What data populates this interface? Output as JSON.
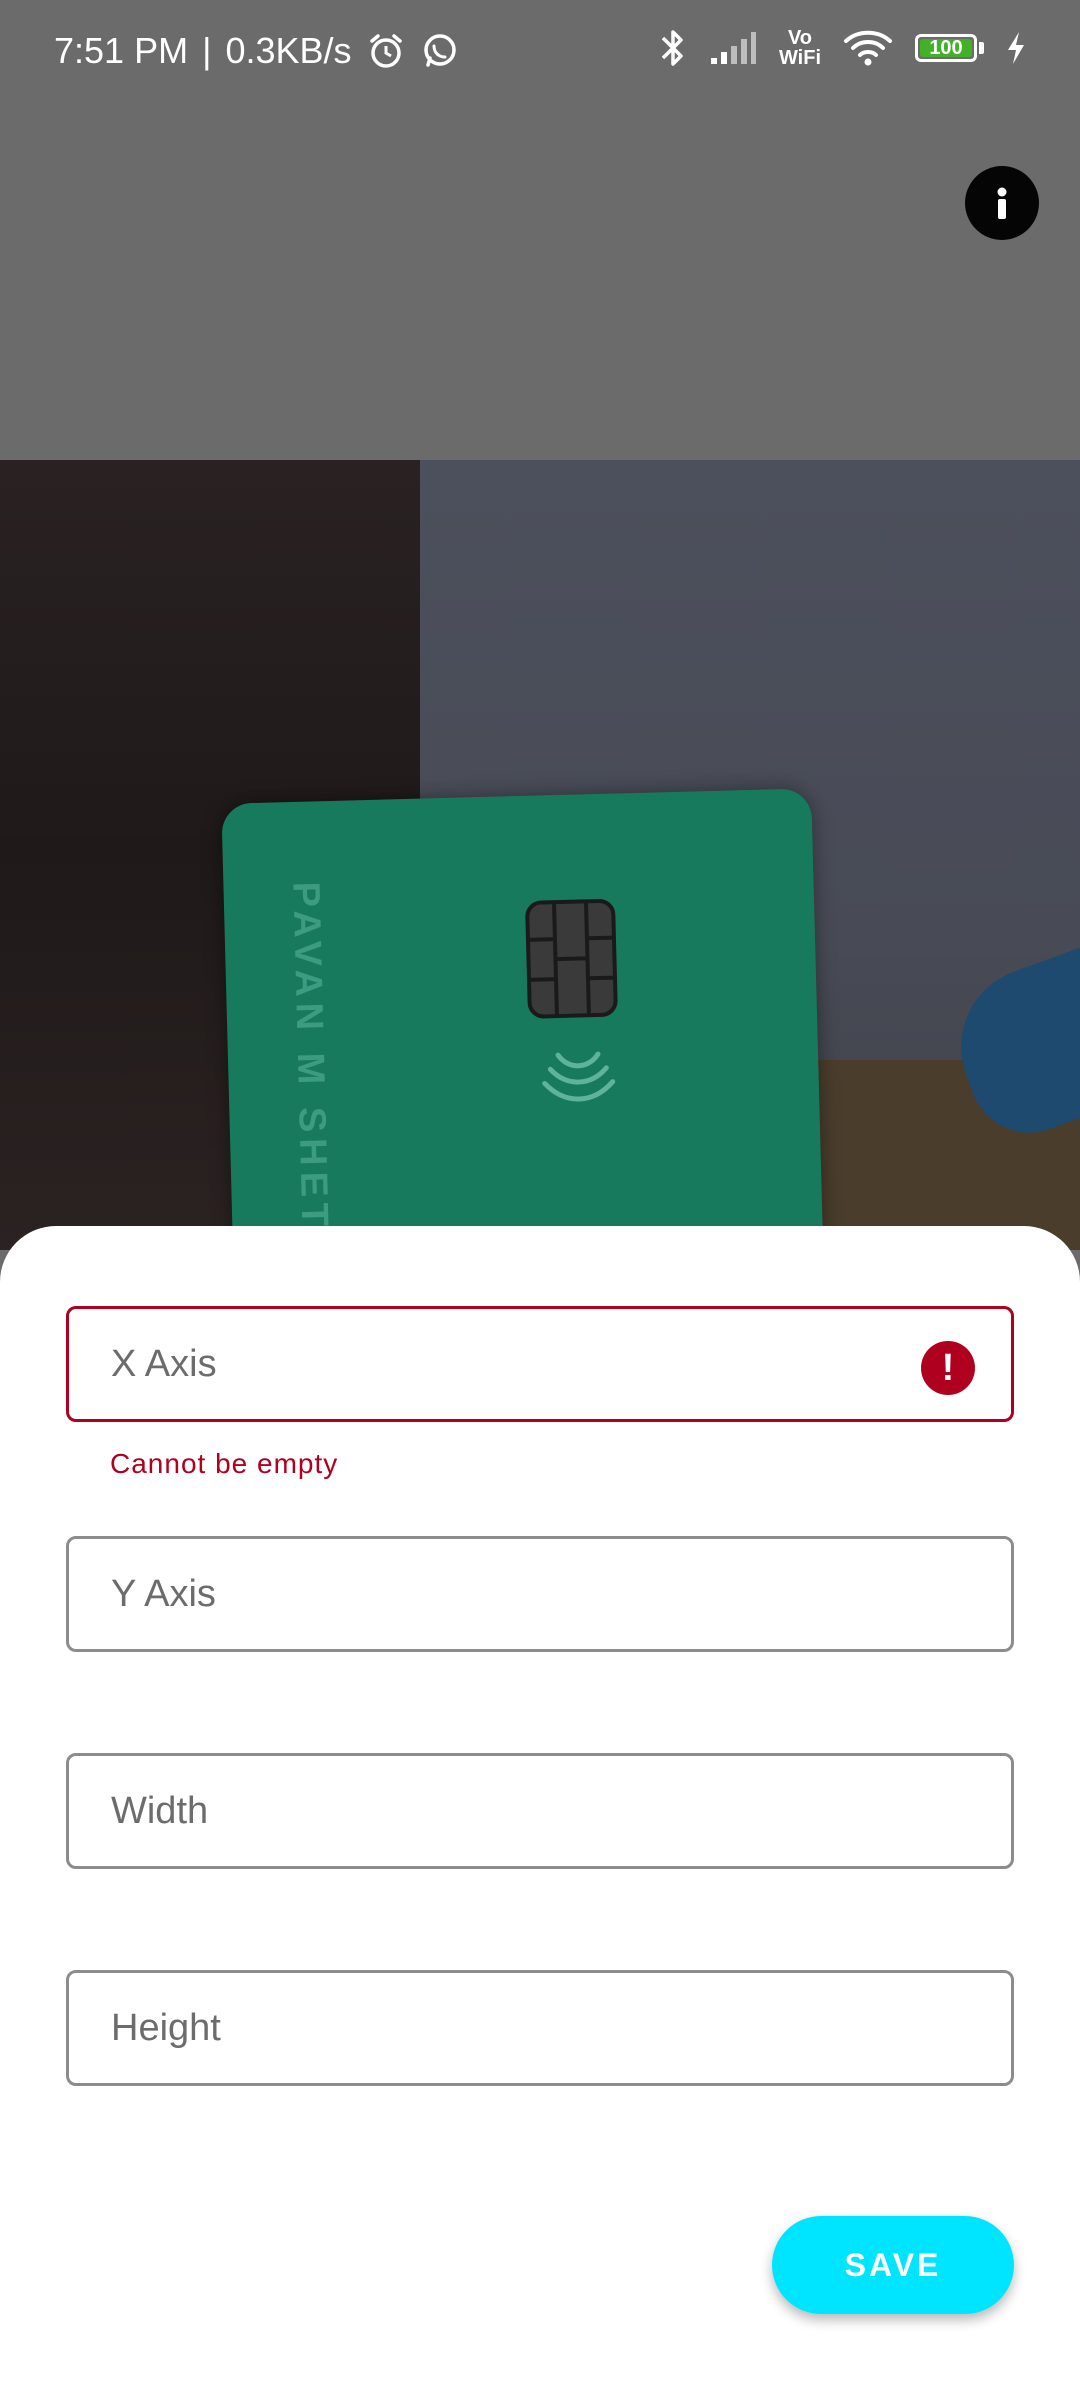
{
  "status_bar": {
    "time": "7:51 PM",
    "separator": "|",
    "net_speed": "0.3KB/s",
    "vowifi_top": "Vo",
    "vowifi_bottom": "WiFi",
    "battery_level": "100",
    "icons": [
      "alarm-icon",
      "whatsapp-icon",
      "bluetooth-icon",
      "signal-icon",
      "vowifi-icon",
      "wifi-icon",
      "battery-icon",
      "charging-icon"
    ]
  },
  "toolbar": {
    "info_icon": "info-icon"
  },
  "camera": {
    "card_text": "PAVAN M SHETT"
  },
  "form": {
    "x_axis": {
      "label": "X Axis",
      "value": "",
      "error": "Cannot be empty"
    },
    "y_axis": {
      "label": "Y Axis",
      "value": ""
    },
    "width": {
      "label": "Width",
      "value": ""
    },
    "height": {
      "label": "Height",
      "value": ""
    },
    "error_icon_glyph": "!",
    "save_label": "SAVE"
  },
  "colors": {
    "error": "#b00020",
    "accent": "#00e5ff",
    "battery": "#43b02a",
    "card": "#187a5c"
  }
}
